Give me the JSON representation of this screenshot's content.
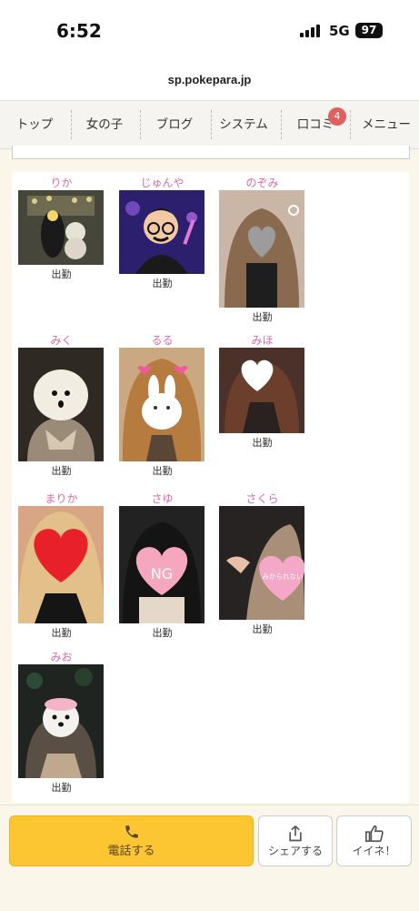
{
  "statusbar": {
    "time": "6:52",
    "network": "5G",
    "battery": "97"
  },
  "browser": {
    "url": "sp.pokepara.jp"
  },
  "nav": {
    "items": [
      {
        "label": "トップ"
      },
      {
        "label": "女の子"
      },
      {
        "label": "ブログ"
      },
      {
        "label": "システム"
      },
      {
        "label": "口コミ"
      },
      {
        "label": "メニュー"
      }
    ],
    "review_badge": "4"
  },
  "girls": [
    {
      "name": "りか",
      "status": "出勤",
      "icon": "avatar-photo"
    },
    {
      "name": "じゅんや",
      "status": "出勤",
      "icon": "avatar-cartoon"
    },
    {
      "name": "のぞみ",
      "status": "出勤",
      "icon": "grey-heart-sticker"
    },
    {
      "name": "みく",
      "status": "出勤",
      "icon": "dumpling-face-sticker"
    },
    {
      "name": "るる",
      "status": "出勤",
      "icon": "rabbit-sticker"
    },
    {
      "name": "みほ",
      "status": "出勤",
      "icon": "white-heart-sticker"
    },
    {
      "name": "まりか",
      "status": "出勤",
      "icon": "red-heart-sticker"
    },
    {
      "name": "さゆ",
      "status": "出勤",
      "icon": "ng-heart-sticker"
    },
    {
      "name": "さくら",
      "status": "出勤",
      "icon": "pink-heart-sticker"
    },
    {
      "name": "みお",
      "status": "出勤",
      "icon": "dog-mask-sticker"
    }
  ],
  "stickers": {
    "ng": "NG",
    "sakura": "みかられない"
  },
  "actions": {
    "call": "電話する",
    "share": "シェアする",
    "like": "イイネ！"
  },
  "colors": {
    "accent": "#fcc633",
    "name": "#e06aa2",
    "badge": "#e35e5e"
  }
}
